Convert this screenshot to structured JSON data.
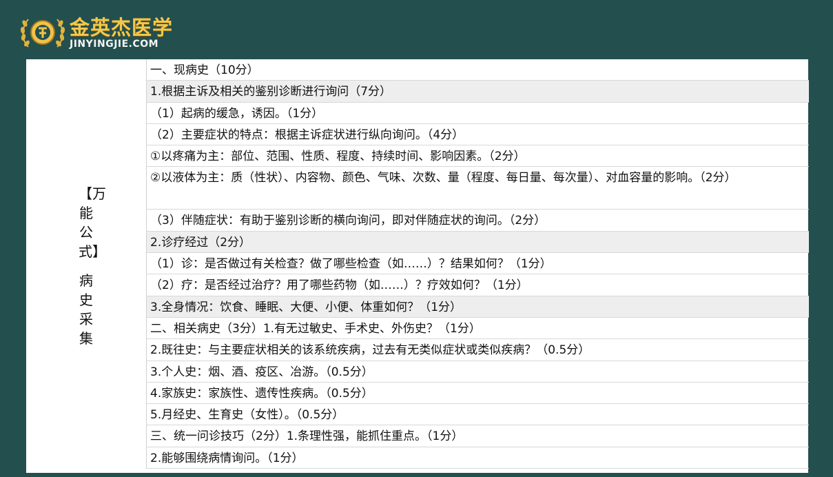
{
  "logo": {
    "name_cn": "金英杰医学",
    "name_en": "JINYINGJIE.COM"
  },
  "side_label": {
    "part1": "【万能公式】",
    "part2": "病史采集"
  },
  "rows": [
    {
      "text": "一、现病史（10分）",
      "shaded": false
    },
    {
      "text": "1.根据主诉及相关的鉴别诊断进行询问（7分）",
      "shaded": true
    },
    {
      "text": "（1）起病的缓急，诱因。（1分）",
      "shaded": false
    },
    {
      "text": "（2）主要症状的特点：根据主诉症状进行纵向询问。（4分）",
      "shaded": false
    },
    {
      "text": "①以疼痛为主：部位、范围、性质、程度、持续时间、影响因素。（2分）",
      "shaded": false
    },
    {
      "text": "②以液体为主：质（性状）、内容物、颜色、气味、次数、量（程度、每日量、每次量）、对血容量的影响。（2分）",
      "shaded": false
    },
    {
      "text": "（3）伴随症状：有助于鉴别诊断的横向询问，即对伴随症状的询问。（2分）",
      "shaded": false
    },
    {
      "text": "2.诊疗经过（2分）",
      "shaded": true
    },
    {
      "text": "（1）诊：是否做过有关检查？做了哪些检查（如……）？结果如何？（1分）",
      "shaded": false
    },
    {
      "text": "（2）疗：是否经过治疗？用了哪些药物（如……）？疗效如何？（1分）",
      "shaded": false
    },
    {
      "text": "3.全身情况：饮食、睡眠、大便、小便、体重如何？（1分）",
      "shaded": true
    },
    {
      "text": "二、相关病史（3分）1.有无过敏史、手术史、外伤史？（1分）",
      "shaded": false
    },
    {
      "text": "2.既往史：与主要症状相关的该系统疾病，过去有无类似症状或类似疾病？（0.5分）",
      "shaded": false
    },
    {
      "text": "3.个人史：烟、酒、疫区、冶游。（0.5分）",
      "shaded": false
    },
    {
      "text": "4.家族史：家族性、遗传性疾病。（0.5分）",
      "shaded": false
    },
    {
      "text": "5.月经史、生育史（女性）。（0.5分）",
      "shaded": false
    },
    {
      "text": "三、统一问诊技巧（2分）1.条理性强，能抓住重点。（1分）",
      "shaded": false
    },
    {
      "text": "2.能够围绕病情询问。（1分）",
      "shaded": false
    }
  ]
}
